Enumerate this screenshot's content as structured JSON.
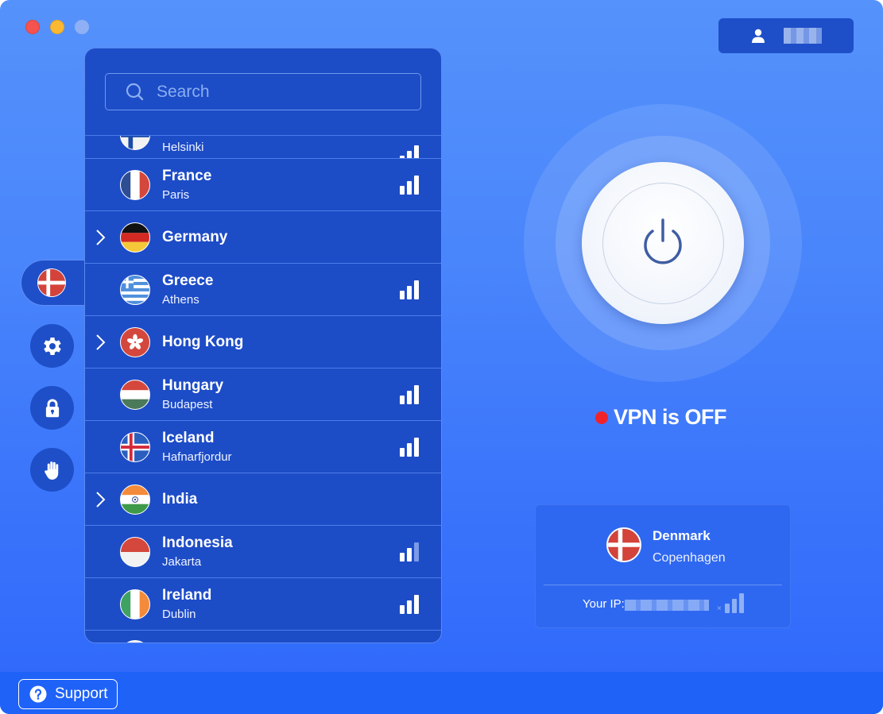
{
  "window": {
    "controls": [
      "close",
      "minimize",
      "maximize"
    ]
  },
  "account": {
    "icon": "user-icon",
    "name": "(redacted)"
  },
  "rail": {
    "active_location_flag": "Denmark",
    "items": [
      {
        "name": "locations",
        "icon": "denmark-flag-icon"
      },
      {
        "name": "settings",
        "icon": "gear-icon"
      },
      {
        "name": "privacy",
        "icon": "lock-icon"
      },
      {
        "name": "blocker",
        "icon": "hand-icon"
      }
    ]
  },
  "search": {
    "placeholder": "Search",
    "value": ""
  },
  "servers": [
    {
      "country": "",
      "city": "Helsinki",
      "flag": "finland",
      "expandable": false,
      "signal": 3,
      "partial": true
    },
    {
      "country": "France",
      "city": "Paris",
      "flag": "france",
      "expandable": false,
      "signal": 3
    },
    {
      "country": "Germany",
      "city": "",
      "flag": "germany",
      "expandable": true,
      "signal": null
    },
    {
      "country": "Greece",
      "city": "Athens",
      "flag": "greece",
      "expandable": false,
      "signal": 3
    },
    {
      "country": "Hong Kong",
      "city": "",
      "flag": "hongkong",
      "expandable": true,
      "signal": null
    },
    {
      "country": "Hungary",
      "city": "Budapest",
      "flag": "hungary",
      "expandable": false,
      "signal": 3
    },
    {
      "country": "Iceland",
      "city": "Hafnarfjordur",
      "flag": "iceland",
      "expandable": false,
      "signal": 3
    },
    {
      "country": "India",
      "city": "",
      "flag": "india",
      "expandable": true,
      "signal": null
    },
    {
      "country": "Indonesia",
      "city": "Jakarta",
      "flag": "indonesia",
      "expandable": false,
      "signal": 2
    },
    {
      "country": "Ireland",
      "city": "Dublin",
      "flag": "ireland",
      "expandable": false,
      "signal": 3
    }
  ],
  "power": {
    "icon": "power-icon",
    "state": "off"
  },
  "status": {
    "text": "VPN is OFF",
    "dot_color": "#f0232a"
  },
  "location": {
    "country": "Denmark",
    "city": "Copenhagen",
    "ip_label": "Your IP:",
    "ip_value": "(redacted)",
    "signal": 0
  },
  "support": {
    "label": "Support",
    "icon": "help-icon"
  },
  "colors": {
    "panel": "#1d4cc7",
    "background_top": "#5592fb",
    "background_bottom": "#2f68fb",
    "bottom_bar": "#1e62f8"
  }
}
